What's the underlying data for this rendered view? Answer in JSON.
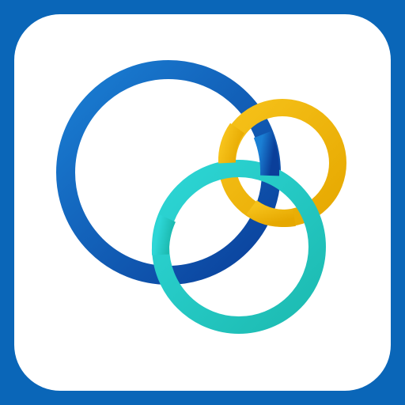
{
  "icon": {
    "name": "interlocking-rings-logo",
    "colors": {
      "frame": "#0a66b8",
      "tile": "#ffffff",
      "ring_blue_light": "#1a7fd4",
      "ring_blue_dark": "#0a3f9a",
      "ring_gold_light": "#f6c21a",
      "ring_gold_dark": "#e6a800",
      "ring_teal_light": "#2dd6d6",
      "ring_teal_dark": "#1cbab0"
    },
    "rings": [
      {
        "name": "blue-ring",
        "color": "blue"
      },
      {
        "name": "gold-ring",
        "color": "gold"
      },
      {
        "name": "teal-ring",
        "color": "teal"
      }
    ]
  }
}
